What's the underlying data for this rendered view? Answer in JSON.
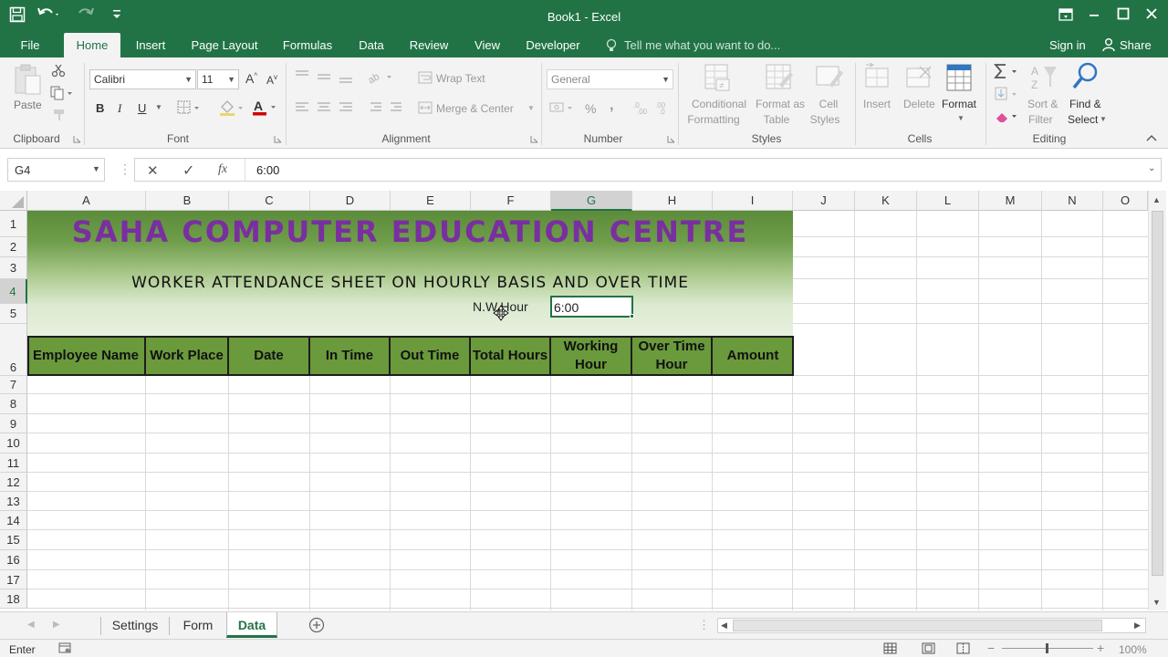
{
  "window": {
    "title": "Book1 - Excel",
    "controls": [
      "ribbon-display-icon",
      "minimize-icon",
      "maximize-icon",
      "close-icon"
    ]
  },
  "qat": {
    "save_icon": "save-icon",
    "undo_icon": "undo-icon",
    "redo_icon": "redo-icon",
    "customize_icon": "customize-qat-icon"
  },
  "tabs": [
    "File",
    "Home",
    "Insert",
    "Page Layout",
    "Formulas",
    "Data",
    "Review",
    "View",
    "Developer"
  ],
  "tell_me": "Tell me what you want to do...",
  "account": {
    "sign_in": "Sign in",
    "share": "Share"
  },
  "ribbon": {
    "clipboard": {
      "label": "Clipboard",
      "paste": "Paste"
    },
    "font": {
      "label": "Font",
      "name": "Calibri",
      "size": "11",
      "bold": "B",
      "italic": "I",
      "underline": "U",
      "grow": "A",
      "shrink": "A",
      "font_color_accent": "#d00000"
    },
    "alignment": {
      "label": "Alignment",
      "wrap": "Wrap Text",
      "merge": "Merge & Center"
    },
    "number": {
      "label": "Number",
      "format": "General",
      "percent": "%",
      "comma": ","
    },
    "styles": {
      "label": "Styles",
      "conditional_1": "Conditional",
      "conditional_2": "Formatting",
      "format_table_1": "Format as",
      "format_table_2": "Table",
      "cell_styles_1": "Cell",
      "cell_styles_2": "Styles"
    },
    "cells": {
      "label": "Cells",
      "insert": "Insert",
      "delete": "Delete",
      "format": "Format"
    },
    "editing": {
      "label": "Editing",
      "sort_1": "Sort &",
      "sort_2": "Filter",
      "find_1": "Find &",
      "find_2": "Select"
    }
  },
  "formula_bar": {
    "name_box": "G4",
    "cancel": "✕",
    "enter": "✓",
    "fx": "fx",
    "content": "6:00"
  },
  "columns": [
    "A",
    "B",
    "C",
    "D",
    "E",
    "F",
    "G",
    "H",
    "I",
    "J",
    "K",
    "L",
    "M",
    "N",
    "O"
  ],
  "selected_column": "G",
  "rows": [
    "1",
    "2",
    "3",
    "4",
    "5",
    "6",
    "7",
    "8",
    "9",
    "10",
    "11",
    "12",
    "13",
    "14",
    "15",
    "16",
    "17",
    "18"
  ],
  "selected_row": "4",
  "sheet": {
    "title": "SAHA COMPUTER EDUCATION CENTRE",
    "title_color": "#7a2fa0",
    "subtitle": "WORKER ATTENDANCE SHEET ON HOURLY BASIS AND OVER TIME",
    "nw_hour_label": "N.W.Hour",
    "nw_hour_value": "6:00",
    "banner_color": "#5a8f3a",
    "header_color": "#6a9a3c",
    "headers": [
      "Employee Name",
      "Work Place",
      "Date",
      "In Time",
      "Out Time",
      "Total Hours",
      "Working Hour",
      "Over Time Hour",
      "Amount"
    ]
  },
  "sheet_tabs": [
    "Settings",
    "Form",
    "Data"
  ],
  "active_sheet": "Data",
  "status": {
    "mode": "Enter",
    "zoom": "100%"
  }
}
